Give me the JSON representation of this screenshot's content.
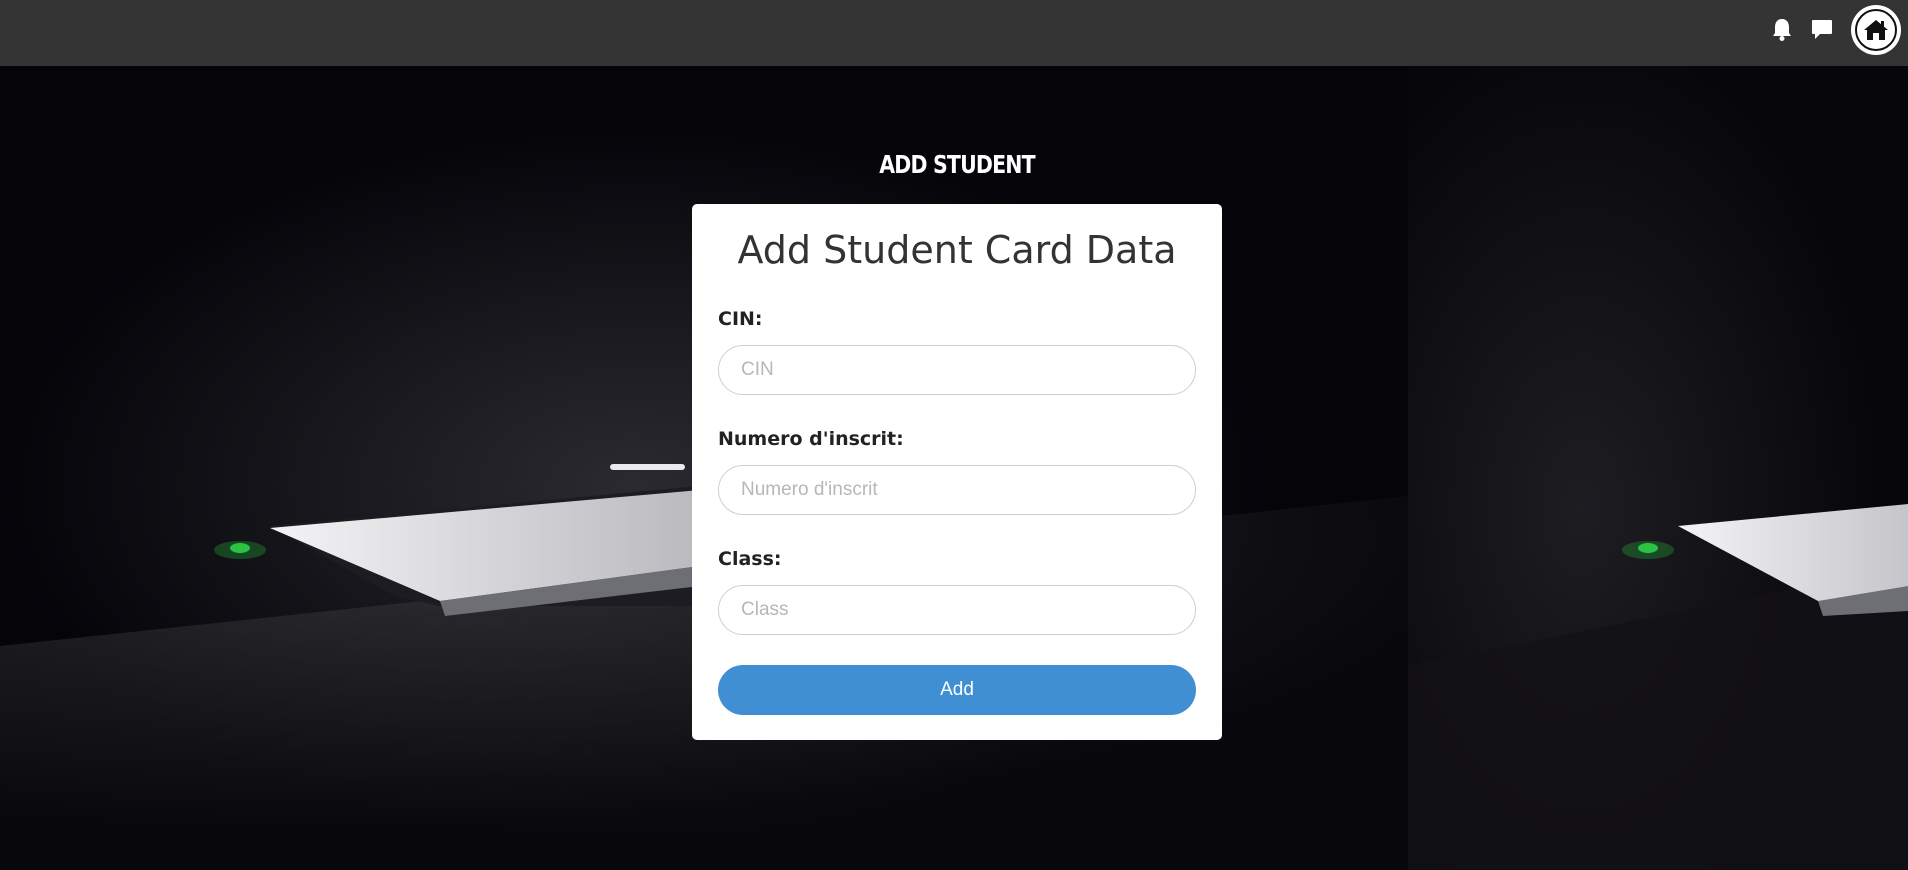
{
  "topbar": {
    "icons": [
      "bell-icon",
      "chat-bubble-icon",
      "home-icon"
    ]
  },
  "page": {
    "heading": "ADD STUDENT"
  },
  "form": {
    "title": "Add Student Card Data",
    "fields": [
      {
        "label": "CIN:",
        "placeholder": "CIN",
        "value": ""
      },
      {
        "label": "Numero d'inscrit:",
        "placeholder": "Numero d'inscrit",
        "value": ""
      },
      {
        "label": "Class:",
        "placeholder": "Class",
        "value": ""
      }
    ],
    "submit_label": "Add"
  },
  "colors": {
    "topbar": "#343434",
    "accent": "#3f8fd2",
    "card": "#ffffff",
    "background": "#06050a"
  }
}
